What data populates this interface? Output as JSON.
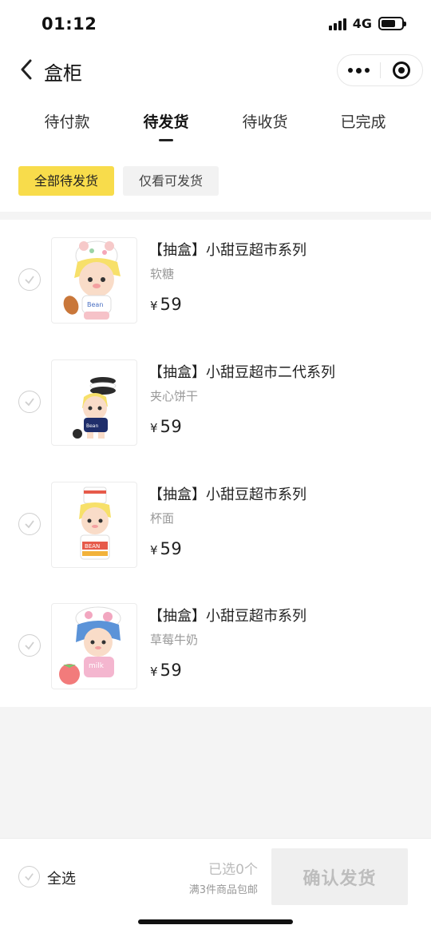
{
  "status_bar": {
    "time": "01:12",
    "network": "4G"
  },
  "nav": {
    "title": "盒柜"
  },
  "tabs": [
    {
      "label": "待付款",
      "active": false
    },
    {
      "label": "待发货",
      "active": true
    },
    {
      "label": "待收货",
      "active": false
    },
    {
      "label": "已完成",
      "active": false
    }
  ],
  "filters": {
    "all_pending": "全部待发货",
    "shippable_only": "仅看可发货"
  },
  "items": [
    {
      "name": "【抽盒】小甜豆超市系列",
      "variant": "软糖",
      "currency": "¥",
      "price": "59",
      "image": "bear-hat-figure-with-drumstick"
    },
    {
      "name": "【抽盒】小甜豆超市二代系列",
      "variant": "夹心饼干",
      "currency": "¥",
      "price": "59",
      "image": "cookie-figure"
    },
    {
      "name": "【抽盒】小甜豆超市系列",
      "variant": "杯面",
      "currency": "¥",
      "price": "59",
      "image": "cup-noodle-figure"
    },
    {
      "name": "【抽盒】小甜豆超市系列",
      "variant": "草莓牛奶",
      "currency": "¥",
      "price": "59",
      "image": "cow-hat-figure-with-strawberry"
    }
  ],
  "bottom_bar": {
    "select_all": "全选",
    "selected_count": "已选0个",
    "shipping_note": "满3件商品包邮",
    "confirm": "确认发货"
  },
  "colors": {
    "accent_yellow": "#f8dc4b",
    "disabled_text": "#bdbdbd"
  }
}
